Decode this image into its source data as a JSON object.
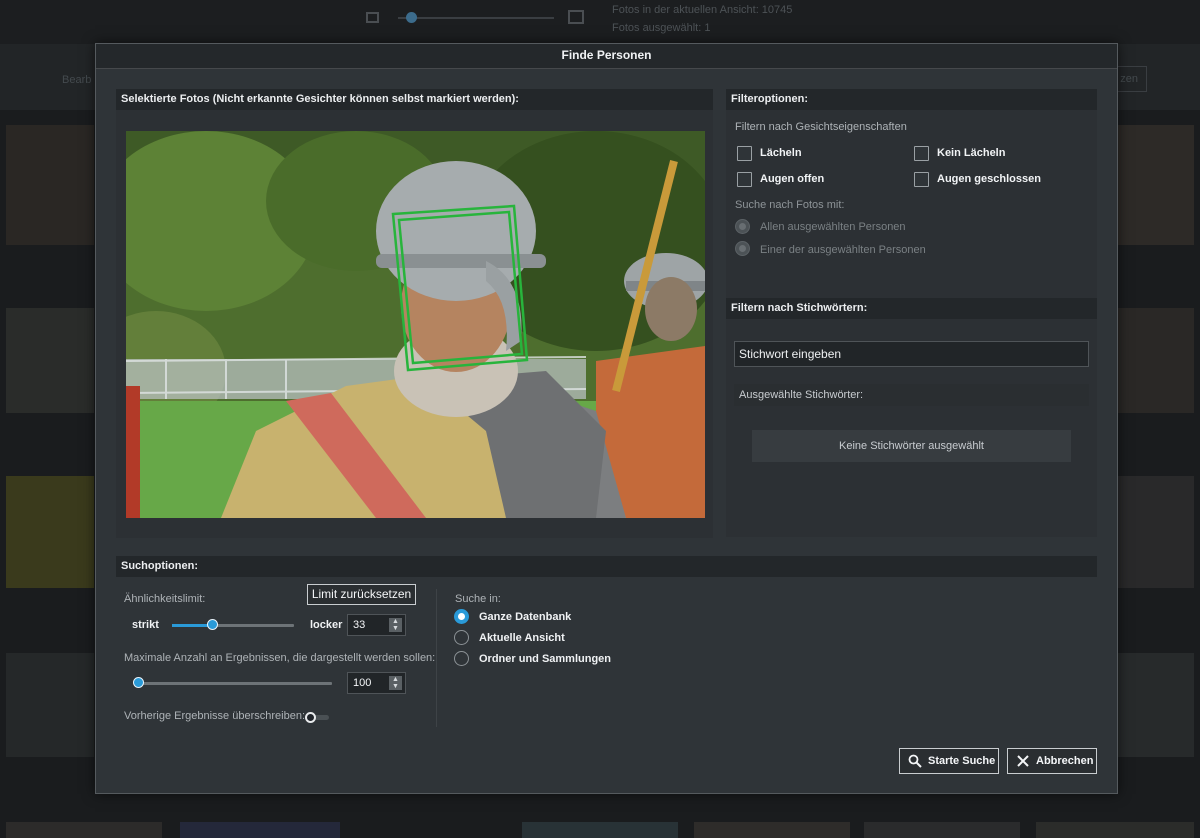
{
  "background": {
    "view_count_text": "Fotos in der aktuellen Ansicht: 10745",
    "selected_count_text": "Fotos ausgewählt: 1",
    "edit_button_label": "Bearb",
    "right_button_label": "zen"
  },
  "dialog": {
    "title": "Finde Personen",
    "photos_header": "Selektierte Fotos (Nicht erkannte Gesichter können selbst markiert werden):",
    "filter_header": "Filteroptionen:",
    "face_filter_label": "Filtern nach Gesichtseigenschaften",
    "face_filters": {
      "smile": "Lächeln",
      "no_smile": "Kein Lächeln",
      "eyes_open": "Augen offen",
      "eyes_closed": "Augen geschlossen"
    },
    "search_photos_with_label": "Suche nach Fotos mit:",
    "search_photos_with_options": [
      "Allen ausgewählten Personen",
      "Einer der ausgewählten Personen"
    ],
    "keyword_header": "Filtern nach Stichwörtern:",
    "keyword_input_value": "Stichwort eingeben",
    "selected_keywords_label": "Ausgewählte Stichwörter:",
    "no_keywords_text": "Keine Stichwörter ausgewählt",
    "search_options_header": "Suchoptionen:",
    "similarity_label": "Ähnlichkeitslimit:",
    "reset_limit_button": "Limit zurücksetzen",
    "strict_label": "strikt",
    "loose_label": "locker",
    "similarity_value": "33",
    "similarity_fraction": 0.33,
    "max_results_label": "Maximale Anzahl an Ergebnissen, die dargestellt werden sollen:",
    "max_results_value": "100",
    "max_results_fraction": 0.0,
    "overwrite_label": "Vorherige Ergebnisse überschreiben:",
    "overwrite_enabled": false,
    "search_in_label": "Suche in:",
    "search_in_options": [
      "Ganze Datenbank",
      "Aktuelle Ansicht",
      "Ordner und Sammlungen"
    ],
    "search_in_selected": 0,
    "start_search_button": "Starte Suche",
    "cancel_button": "Abbrechen"
  },
  "colors": {
    "accent": "#2a9ad8",
    "dialog_background": "#2f3438",
    "face_box": "#28b43c"
  }
}
